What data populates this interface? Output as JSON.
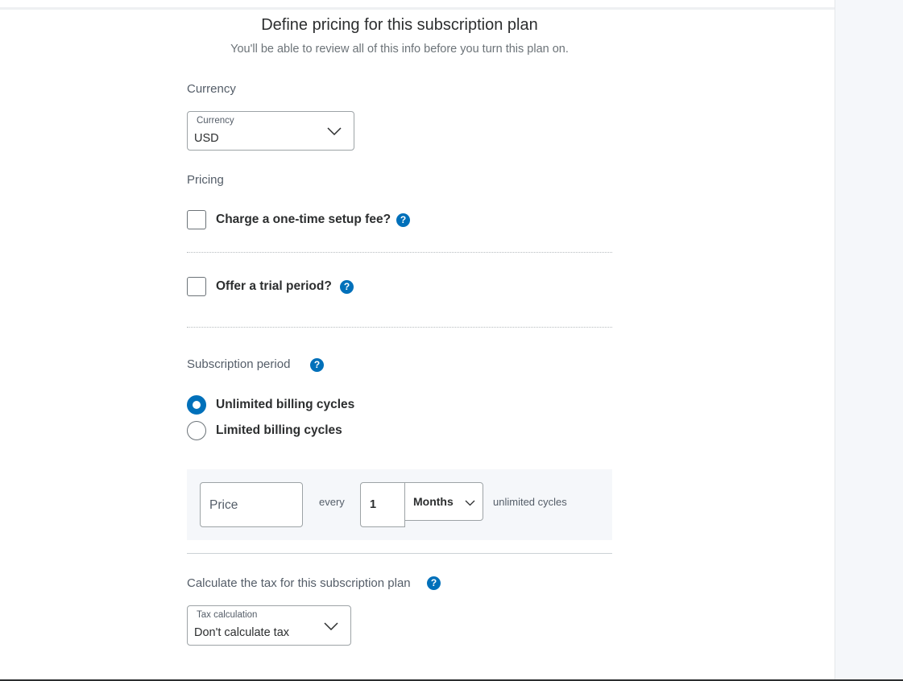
{
  "header": {
    "title": "Define pricing for this subscription plan",
    "subtitle": "You'll be able to review all of this info before you turn this plan on."
  },
  "currency": {
    "section_label": "Currency",
    "field_label": "Currency",
    "value": "USD"
  },
  "pricing": {
    "section_label": "Pricing",
    "setup_fee_label": "Charge a one-time setup fee?",
    "setup_fee_checked": false,
    "trial_label": "Offer a trial period?",
    "trial_checked": false
  },
  "subscription_period": {
    "section_label": "Subscription period",
    "options": [
      {
        "label": "Unlimited billing cycles",
        "selected": true
      },
      {
        "label": "Limited billing cycles",
        "selected": false
      }
    ]
  },
  "billing": {
    "price_placeholder": "Price",
    "every_label": "every",
    "interval_count": "1",
    "interval_unit": "Months",
    "cycles_label": "unlimited cycles"
  },
  "tax": {
    "section_label": "Calculate the tax for this subscription plan",
    "field_label": "Tax calculation",
    "value": "Don't calculate tax"
  },
  "icons": {
    "help": "?",
    "help_color": "#0070ba",
    "accent": "#0070ba"
  }
}
